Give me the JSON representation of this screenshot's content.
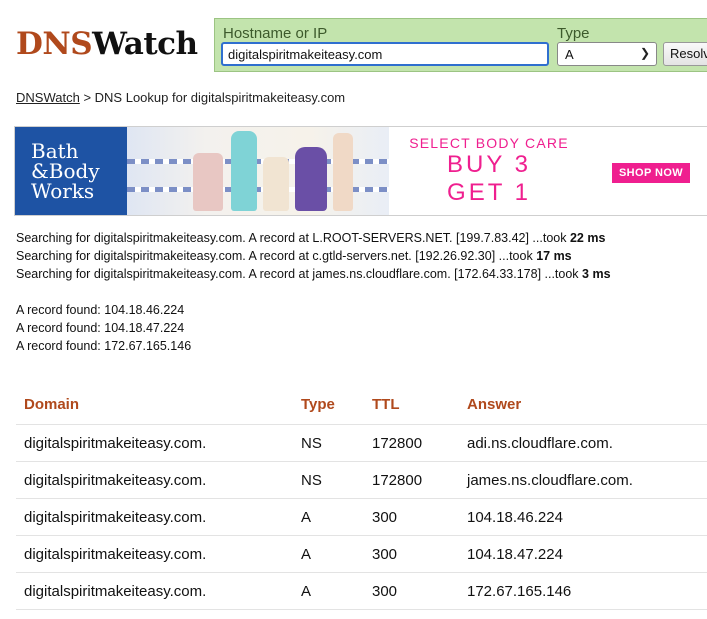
{
  "logo": {
    "part1": "DNS",
    "part2": "Watch"
  },
  "search": {
    "hostname_label": "Hostname or IP",
    "hostname_value": "digitalspiritmakeiteasy.com",
    "type_label": "Type",
    "type_value": "A",
    "resolve_label": "Resolve"
  },
  "breadcrumb": {
    "home": "DNSWatch",
    "separator": ">",
    "current": "DNS Lookup for digitalspiritmakeiteasy.com"
  },
  "ad": {
    "brand_lines": [
      "Bath",
      "&Body",
      "Works"
    ],
    "headline1": "SELECT BODY CARE",
    "headline2": "BUY 3",
    "headline3": "GET 1",
    "cta": "SHOP NOW",
    "colors": {
      "brand_blue": "#1e53a4",
      "accent_pink": "#ef1f8f"
    }
  },
  "search_log": [
    {
      "text": "Searching for digitalspiritmakeiteasy.com. A record at L.ROOT-SERVERS.NET. [199.7.83.42] ...took",
      "time": "22 ms"
    },
    {
      "text": "Searching for digitalspiritmakeiteasy.com. A record at c.gtld-servers.net. [192.26.92.30] ...took",
      "time": "17 ms"
    },
    {
      "text": "Searching for digitalspiritmakeiteasy.com. A record at james.ns.cloudflare.com. [172.64.33.178] ...took",
      "time": "3 ms"
    }
  ],
  "found": [
    "A record found: 104.18.46.224",
    "A record found: 104.18.47.224",
    "A record found: 172.67.165.146"
  ],
  "table": {
    "headers": [
      "Domain",
      "Type",
      "TTL",
      "Answer"
    ],
    "rows": [
      [
        "digitalspiritmakeiteasy.com.",
        "NS",
        "172800",
        "adi.ns.cloudflare.com."
      ],
      [
        "digitalspiritmakeiteasy.com.",
        "NS",
        "172800",
        "james.ns.cloudflare.com."
      ],
      [
        "digitalspiritmakeiteasy.com.",
        "A",
        "300",
        "104.18.46.224"
      ],
      [
        "digitalspiritmakeiteasy.com.",
        "A",
        "300",
        "104.18.47.224"
      ],
      [
        "digitalspiritmakeiteasy.com.",
        "A",
        "300",
        "172.67.165.146"
      ]
    ]
  },
  "colors": {
    "accent": "#b0491c",
    "search_panel": "#c3e4ad",
    "input_focus": "#2f6fcf"
  }
}
